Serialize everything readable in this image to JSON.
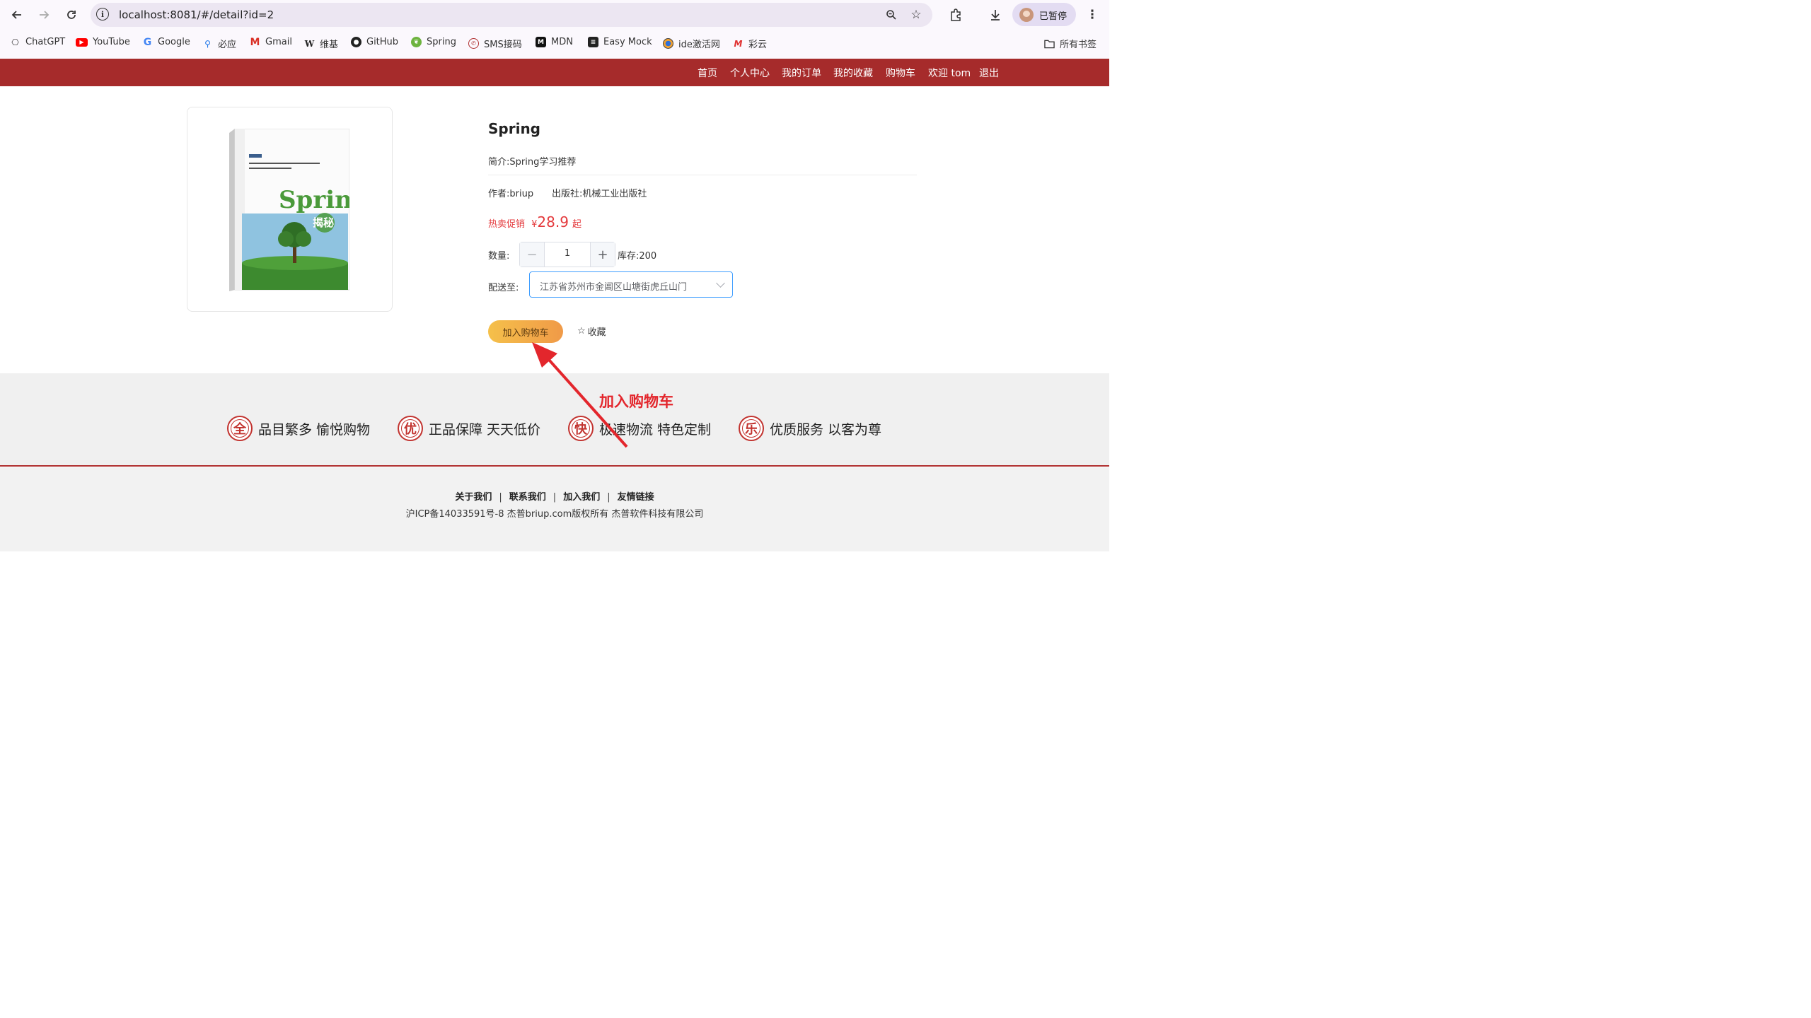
{
  "browser": {
    "url": "localhost:8081/#/detail?id=2",
    "profile_label": "已暂停",
    "bookmarks": [
      {
        "label": "ChatGPT",
        "icon": "chatgpt-icon"
      },
      {
        "label": "YouTube",
        "icon": "youtube-icon"
      },
      {
        "label": "Google",
        "icon": "google-icon"
      },
      {
        "label": "必应",
        "icon": "bing-icon"
      },
      {
        "label": "Gmail",
        "icon": "gmail-icon"
      },
      {
        "label": "维基",
        "icon": "wikipedia-icon"
      },
      {
        "label": "GitHub",
        "icon": "github-icon"
      },
      {
        "label": "Spring",
        "icon": "spring-icon"
      },
      {
        "label": "SMS接码",
        "icon": "sms-icon"
      },
      {
        "label": "MDN",
        "icon": "mdn-icon"
      },
      {
        "label": "Easy Mock",
        "icon": "easymock-icon"
      },
      {
        "label": "ide激活网",
        "icon": "ide-icon"
      },
      {
        "label": "彩云",
        "icon": "caiyun-icon"
      }
    ],
    "all_bookmarks": "所有书签"
  },
  "site_nav": {
    "items": [
      "首页",
      "个人中心",
      "我的订单",
      "我的收藏",
      "购物车",
      "欢迎 tom",
      "退出"
    ]
  },
  "product": {
    "title": "Spring",
    "intro_label": "简介:",
    "intro": "Spring学习推荐",
    "author_label": "作者:",
    "author": "briup",
    "publisher_label": "出版社:",
    "publisher": "机械工业出版社",
    "promo_label": "热卖促销",
    "currency": "¥",
    "price": "28.9",
    "price_suffix": "起",
    "quantity_label": "数量:",
    "quantity": "1",
    "stock_label": "库存:",
    "stock": "200",
    "ship_label": "配送至:",
    "ship_address": "江苏省苏州市金阊区山塘街虎丘山门",
    "add_cart": "加入购物车",
    "favorite": "收藏",
    "book_cover_title": "Spring",
    "book_cover_sub": "揭秘"
  },
  "features": [
    {
      "badge": "全",
      "text": "品目繁多 愉悦购物"
    },
    {
      "badge": "优",
      "text": "正品保障 天天低价"
    },
    {
      "badge": "快",
      "text": "极速物流 特色定制"
    },
    {
      "badge": "乐",
      "text": "优质服务 以客为尊"
    }
  ],
  "footer": {
    "links": [
      "关于我们",
      "联系我们",
      "加入我们",
      "友情链接"
    ],
    "copyright": "沪ICP备14033591号-8 杰普briup.com版权所有 杰普软件科技有限公司"
  },
  "annotation": {
    "text": "加入购物车",
    "color": "#e3262c"
  },
  "colors": {
    "nav_bg": "#a62b2b",
    "price": "#e4393c",
    "button_gradient": [
      "#f5c04a",
      "#f09a48"
    ]
  }
}
